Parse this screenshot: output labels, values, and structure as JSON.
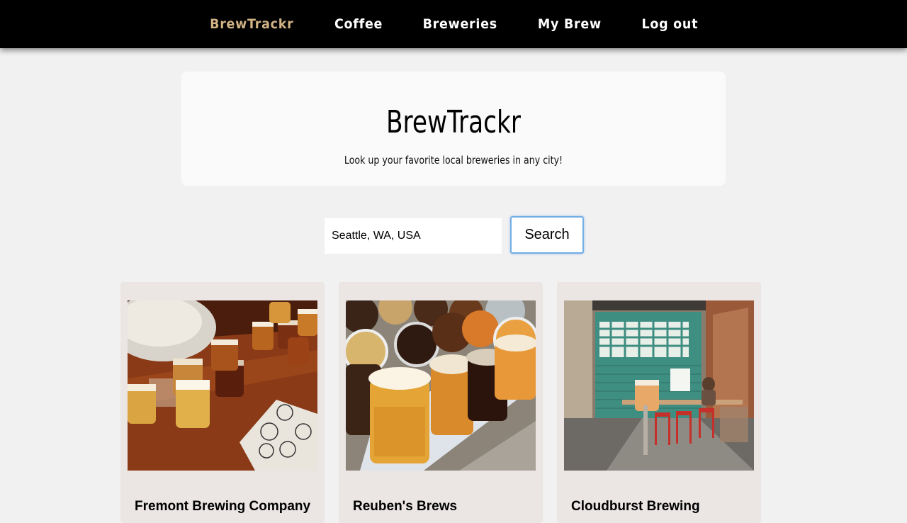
{
  "nav": {
    "brand": "BrewTrackr",
    "items": [
      "Coffee",
      "Breweries",
      "My Brew",
      "Log out"
    ]
  },
  "hero": {
    "title": "BrewTrackr",
    "subtitle": "Look up your favorite local breweries in any city!"
  },
  "search": {
    "value": "Seattle, WA, USA",
    "button_label": "Search"
  },
  "breweries": [
    {
      "name": "Fremont Brewing Company",
      "photo": "beer-flight-photo"
    },
    {
      "name": "Reuben's Brews",
      "photo": "beer-glasses-photo"
    },
    {
      "name": "Cloudburst Brewing",
      "photo": "taproom-interior-photo"
    }
  ],
  "colors": {
    "nav_background": "#000000",
    "brand_accent": "#d1b386",
    "page_background": "#f2f1f1",
    "card_background": "#ebe5e4",
    "focus_outline": "#74aee6"
  }
}
